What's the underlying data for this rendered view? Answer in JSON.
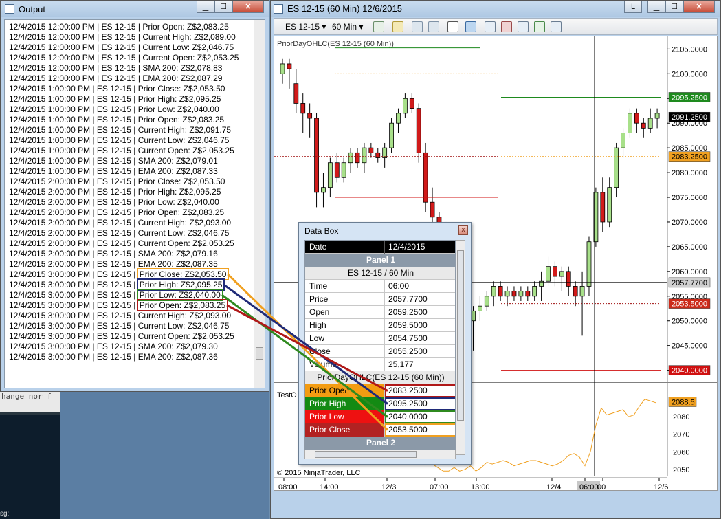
{
  "output_window": {
    "title": "Output",
    "lines": [
      "12/4/2015 12:00:00 PM | ES 12-15 | Prior Open: Z$2,083.25",
      "12/4/2015 12:00:00 PM | ES 12-15 | Current High: Z$2,089.00",
      "12/4/2015 12:00:00 PM | ES 12-15 | Current Low: Z$2,046.75",
      "12/4/2015 12:00:00 PM | ES 12-15 | Current Open: Z$2,053.25",
      "12/4/2015 12:00:00 PM | ES 12-15 | SMA 200: Z$2,078.83",
      "12/4/2015 12:00:00 PM | ES 12-15 | EMA 200: Z$2,087.29",
      "12/4/2015 1:00:00 PM | ES 12-15 | Prior Close: Z$2,053.50",
      "12/4/2015 1:00:00 PM | ES 12-15 | Prior High: Z$2,095.25",
      "12/4/2015 1:00:00 PM | ES 12-15 | Prior Low: Z$2,040.00",
      "12/4/2015 1:00:00 PM | ES 12-15 | Prior Open: Z$2,083.25",
      "12/4/2015 1:00:00 PM | ES 12-15 | Current High: Z$2,091.75",
      "12/4/2015 1:00:00 PM | ES 12-15 | Current Low: Z$2,046.75",
      "12/4/2015 1:00:00 PM | ES 12-15 | Current Open: Z$2,053.25",
      "12/4/2015 1:00:00 PM | ES 12-15 | SMA 200: Z$2,079.01",
      "12/4/2015 1:00:00 PM | ES 12-15 | EMA 200: Z$2,087.33",
      "12/4/2015 2:00:00 PM | ES 12-15 | Prior Close: Z$2,053.50",
      "12/4/2015 2:00:00 PM | ES 12-15 | Prior High: Z$2,095.25",
      "12/4/2015 2:00:00 PM | ES 12-15 | Prior Low: Z$2,040.00",
      "12/4/2015 2:00:00 PM | ES 12-15 | Prior Open: Z$2,083.25",
      "12/4/2015 2:00:00 PM | ES 12-15 | Current High: Z$2,093.00",
      "12/4/2015 2:00:00 PM | ES 12-15 | Current Low: Z$2,046.75",
      "12/4/2015 2:00:00 PM | ES 12-15 | Current Open: Z$2,053.25",
      "12/4/2015 2:00:00 PM | ES 12-15 | SMA 200: Z$2,079.16",
      "12/4/2015 2:00:00 PM | ES 12-15 | EMA 200: Z$2,087.35"
    ],
    "highlighted_lines": [
      {
        "prefix": "12/4/2015 3:00:00 PM | ES 12-15 | ",
        "text": "Prior Close: Z$2,053.50",
        "color": "orange"
      },
      {
        "prefix": "12/4/2015 3:00:00 PM | ES 12-15 | ",
        "text": "Prior High: Z$2,095.25",
        "color": "navy"
      },
      {
        "prefix": "12/4/2015 3:00:00 PM | ES 12-15 | ",
        "text": "Prior Low: Z$2,040.00",
        "color": "green"
      },
      {
        "prefix": "12/4/2015 3:00:00 PM | ES 12-15 | ",
        "text": "Prior Open: Z$2,083.25",
        "color": "red"
      }
    ],
    "tail_lines": [
      "12/4/2015 3:00:00 PM | ES 12-15 | Current High: Z$2,093.00",
      "12/4/2015 3:00:00 PM | ES 12-15 | Current Low: Z$2,046.75",
      "12/4/2015 3:00:00 PM | ES 12-15 | Current Open: Z$2,053.25",
      "12/4/2015 3:00:00 PM | ES 12-15 | SMA 200: Z$2,079.30",
      "12/4/2015 3:00:00 PM | ES 12-15 | EMA 200: Z$2,087.36"
    ],
    "background_snippet": "hange nor f",
    "background_label": "sg:"
  },
  "chart_window": {
    "title": "ES 12-15 (60 Min)  12/6/2015",
    "title_button": "L",
    "toolbar": {
      "instrument": "ES 12-15",
      "interval": "60 Min"
    },
    "indicator_label": "PriorDayOHLC(ES 12-15 (60 Min))",
    "subpanel_label": "TestO",
    "copyright": "© 2015 NinjaTrader, LLC"
  },
  "chart_data": {
    "type": "candlestick",
    "instrument": "ES 12-15",
    "interval": "60 Min",
    "y_ticks": [
      "2105.0000",
      "2100.0000",
      "2095.0000",
      "2090.0000",
      "2085.0000",
      "2080.0000",
      "2075.0000",
      "2070.0000",
      "2065.0000",
      "2060.0000",
      "2055.0000",
      "2050.0000",
      "2045.0000",
      "2040.0000"
    ],
    "ylim": [
      2038,
      2107
    ],
    "x_ticks": [
      "08:00",
      "14:00",
      "12/3",
      "07:00",
      "13:00",
      "12/4",
      "06:00",
      "00",
      "12/6"
    ],
    "price_markers": [
      {
        "label": "2095.2500",
        "value": 2095.25,
        "color": "#1e8a1e"
      },
      {
        "label": "2091.2500",
        "value": 2091.25,
        "color": "#000000"
      },
      {
        "label": "2083.2500",
        "value": 2083.25,
        "color": "#f0a020"
      },
      {
        "label": "2057.7700",
        "value": 2057.77,
        "color": "#d0d0d0"
      },
      {
        "label": "2053.5000",
        "value": 2053.5,
        "color": "#cc2a1a"
      },
      {
        "label": "2040.0000",
        "value": 2040.0,
        "color": "#d01010"
      }
    ],
    "lower_panel": {
      "y_ticks": [
        "2080",
        "2070",
        "2060",
        "2050"
      ],
      "ylim": [
        2046,
        2093
      ],
      "marker": {
        "label": "2088.5",
        "value": 2088.5
      },
      "series_values": [
        2053,
        2051,
        2049,
        2049,
        2051,
        2049,
        2050,
        2052,
        2049,
        2051,
        2054,
        2053,
        2054,
        2055,
        2054,
        2052,
        2053,
        2054,
        2055,
        2055,
        2054,
        2053,
        2052,
        2053,
        2055,
        2058,
        2059,
        2057,
        2052,
        2060,
        2075,
        2085,
        2081,
        2082,
        2083,
        2084,
        2080,
        2081,
        2086,
        2090,
        2089,
        2088
      ]
    },
    "candles": [
      [
        2100,
        2103,
        2098,
        2102
      ],
      [
        2102,
        2103,
        2097,
        2101
      ],
      [
        2098,
        2101,
        2092,
        2094
      ],
      [
        2094,
        2096,
        2088,
        2092
      ],
      [
        2092,
        2094,
        2087,
        2091
      ],
      [
        2091,
        2092,
        2073,
        2076
      ],
      [
        2076,
        2080,
        2073,
        2077
      ],
      [
        2077,
        2083,
        2075,
        2082
      ],
      [
        2082,
        2084,
        2078,
        2079
      ],
      [
        2079,
        2083,
        2078,
        2082
      ],
      [
        2082,
        2085,
        2080,
        2084
      ],
      [
        2084,
        2085,
        2081,
        2082
      ],
      [
        2082,
        2086,
        2080,
        2085
      ],
      [
        2085,
        2086,
        2083,
        2084
      ],
      [
        2084,
        2085,
        2082,
        2083
      ],
      [
        2083,
        2086,
        2081,
        2085
      ],
      [
        2085,
        2091,
        2084,
        2090
      ],
      [
        2090,
        2093,
        2088,
        2092
      ],
      [
        2092,
        2096,
        2091,
        2095
      ],
      [
        2095,
        2096,
        2092,
        2093
      ],
      [
        2093,
        2094,
        2082,
        2084
      ],
      [
        2084,
        2086,
        2072,
        2074
      ],
      [
        2074,
        2077,
        2070,
        2071
      ],
      [
        2071,
        2072,
        2066,
        2068
      ],
      [
        2068,
        2070,
        2064,
        2066
      ],
      [
        2066,
        2067,
        2058,
        2060
      ],
      [
        2060,
        2061,
        2051,
        2053
      ],
      [
        2053,
        2055,
        2046,
        2050
      ],
      [
        2050,
        2053,
        2044,
        2052
      ],
      [
        2052,
        2055,
        2050,
        2053
      ],
      [
        2053,
        2056,
        2052,
        2055
      ],
      [
        2055,
        2058,
        2053,
        2057
      ],
      [
        2057,
        2058,
        2054,
        2055
      ],
      [
        2055,
        2057,
        2053,
        2056
      ],
      [
        2056,
        2057,
        2054,
        2055
      ],
      [
        2055,
        2057,
        2054,
        2056
      ],
      [
        2056,
        2057,
        2054,
        2055
      ],
      [
        2055,
        2058,
        2054,
        2057
      ],
      [
        2057,
        2060,
        2054,
        2058
      ],
      [
        2058,
        2063,
        2057,
        2061
      ],
      [
        2061,
        2062,
        2057,
        2059
      ],
      [
        2059,
        2061,
        2056,
        2060
      ],
      [
        2060,
        2061,
        2055,
        2057
      ],
      [
        2057,
        2058,
        2053,
        2055
      ],
      [
        2055,
        2060,
        2047,
        2057
      ],
      [
        2057,
        2067,
        2055,
        2066
      ],
      [
        2066,
        2077,
        2065,
        2076
      ],
      [
        2076,
        2079,
        2068,
        2070
      ],
      [
        2070,
        2079,
        2069,
        2077
      ],
      [
        2077,
        2086,
        2075,
        2085
      ],
      [
        2085,
        2089,
        2083,
        2088
      ],
      [
        2088,
        2093,
        2087,
        2092
      ],
      [
        2092,
        2093,
        2088,
        2090
      ],
      [
        2090,
        2091,
        2087,
        2089
      ],
      [
        2089,
        2093,
        2088,
        2091
      ],
      [
        2091,
        2093,
        2089,
        2092
      ]
    ]
  },
  "data_box": {
    "title": "Data Box",
    "close": "x",
    "header": {
      "key": "Date",
      "value": "12/4/2015"
    },
    "panel1": "Panel 1",
    "series_label": "ES 12-15 / 60 Min",
    "rows": [
      {
        "key": "Time",
        "value": "06:00"
      },
      {
        "key": "Price",
        "value": "2057.7700"
      },
      {
        "key": "Open",
        "value": "2059.2500"
      },
      {
        "key": "High",
        "value": "2059.5000"
      },
      {
        "key": "Low",
        "value": "2054.7500"
      },
      {
        "key": "Close",
        "value": "2055.2500"
      },
      {
        "key": "Volume",
        "value": "25,177"
      }
    ],
    "indicator_label": "PriorDayOHLC(ES 12-15 (60 Min))",
    "indicator_rows": [
      {
        "key": "Prior Open",
        "value": "2083.2500",
        "bg": "#f39c12",
        "fg": "#000000",
        "border": "#b01818"
      },
      {
        "key": "Prior High",
        "value": "2095.2500",
        "bg": "#138a13",
        "fg": "#ffffff",
        "border": "#1f2a78"
      },
      {
        "key": "Prior Low",
        "value": "2040.0000",
        "bg": "#ee1111",
        "fg": "#ffffff",
        "border": "#2f8a1f"
      },
      {
        "key": "Prior Close",
        "value": "2053.5000",
        "bg": "#b22222",
        "fg": "#ffffff",
        "border": "#f0a020"
      }
    ],
    "panel2": "Panel 2"
  }
}
